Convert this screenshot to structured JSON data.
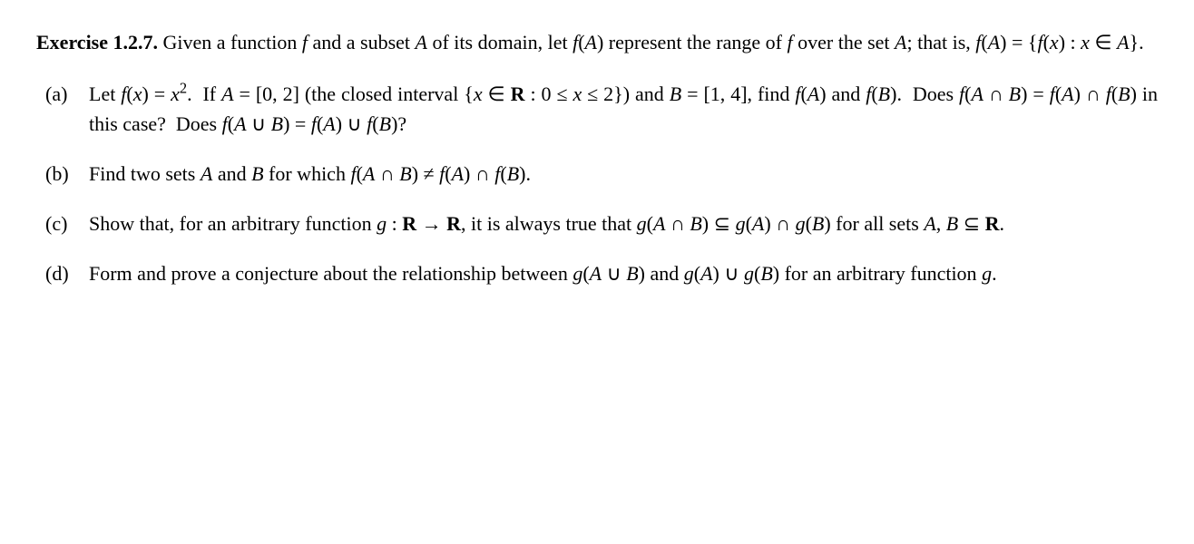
{
  "intro": {
    "label": "Exercise 1.2.7.",
    "text_html": "Given a function <span class='mi'>f</span> and a subset <span class='mi'>A</span> of its domain, let <span class='mi'>f</span>(<span class='mi'>A</span>) represent the range of <span class='mi'>f</span> over the set <span class='mi'>A</span>; that is, <span class='mi'>f</span>(<span class='mi'>A</span>) = {<span class='mi'>f</span>(<span class='mi'>x</span>) : <span class='mi'>x</span> ∈ <span class='mi'>A</span>}."
  },
  "items": [
    {
      "marker": "(a)",
      "text_html": "Let <span class='mi'>f</span>(<span class='mi'>x</span>) = <span class='mi'>x</span><span class='sup'>2</span>. &nbsp;If <span class='mi'>A</span> = [0, 2] (the closed interval {<span class='mi'>x</span> ∈ <span class='bb'>R</span> : 0 ≤ <span class='mi'>x</span> ≤ 2}) and <span class='mi'>B</span> = [1, 4], find <span class='mi'>f</span>(<span class='mi'>A</span>) and <span class='mi'>f</span>(<span class='mi'>B</span>). &nbsp;Does <span class='mi'>f</span>(<span class='mi'>A</span> ∩ <span class='mi'>B</span>) = <span class='mi'>f</span>(<span class='mi'>A</span>) ∩ <span class='mi'>f</span>(<span class='mi'>B</span>) in this case? &nbsp;Does <span class='mi'>f</span>(<span class='mi'>A</span> ∪ <span class='mi'>B</span>) = <span class='mi'>f</span>(<span class='mi'>A</span>) ∪ <span class='mi'>f</span>(<span class='mi'>B</span>)?"
    },
    {
      "marker": "(b)",
      "text_html": "Find two sets <span class='mi'>A</span> and <span class='mi'>B</span> for which <span class='mi'>f</span>(<span class='mi'>A</span> ∩ <span class='mi'>B</span>) ≠ <span class='mi'>f</span>(<span class='mi'>A</span>) ∩ <span class='mi'>f</span>(<span class='mi'>B</span>)."
    },
    {
      "marker": "(c)",
      "text_html": "Show that, for an arbitrary function <span class='mi'>g</span> : <span class='bb'>R</span> → <span class='bb'>R</span>, it is always true that <span class='mi'>g</span>(<span class='mi'>A</span> ∩ <span class='mi'>B</span>) ⊆ <span class='mi'>g</span>(<span class='mi'>A</span>) ∩ <span class='mi'>g</span>(<span class='mi'>B</span>) for all sets <span class='mi'>A</span>, <span class='mi'>B</span> ⊆ <span class='bb'>R</span>."
    },
    {
      "marker": "(d)",
      "text_html": "Form and prove a conjecture about the relationship between <span class='mi'>g</span>(<span class='mi'>A</span> ∪ <span class='mi'>B</span>) and <span class='mi'>g</span>(<span class='mi'>A</span>) ∪ <span class='mi'>g</span>(<span class='mi'>B</span>) for an arbitrary function <span class='mi'>g</span>."
    }
  ]
}
